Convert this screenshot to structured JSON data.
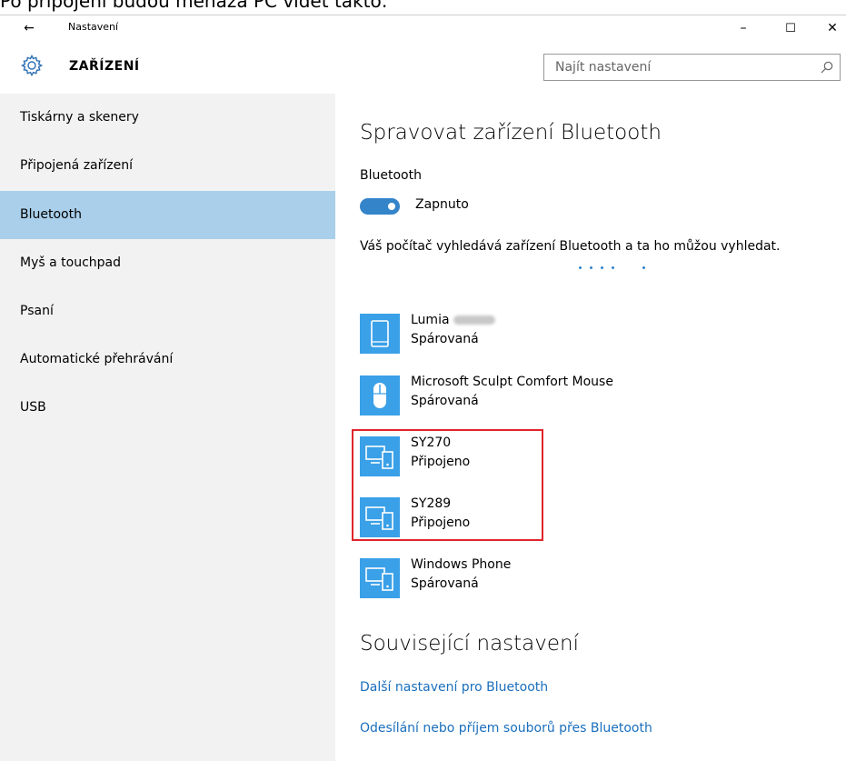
{
  "caption": "Po připojení budou menáža PČ vidět takto:",
  "window": {
    "app_title": "Nastavení",
    "controls": {
      "minimize": "–",
      "maximize": "☐",
      "close": "✕"
    }
  },
  "header": {
    "section_title": "ZAŘÍZENÍ",
    "search_placeholder": "Najít nastavení"
  },
  "sidebar": {
    "items": [
      {
        "label": "Tiskárny a skenery"
      },
      {
        "label": "Připojená zařízení"
      },
      {
        "label": "Bluetooth"
      },
      {
        "label": "Myš a touchpad"
      },
      {
        "label": "Psaní"
      },
      {
        "label": "Automatické přehrávání"
      },
      {
        "label": "USB"
      }
    ],
    "active": "Bluetooth"
  },
  "main": {
    "title": "Spravovat zařízení Bluetooth",
    "bluetooth_label": "Bluetooth",
    "toggle_state": "Zapnuto",
    "discover_text": "Váš počítač vyhledává zařízení Bluetooth a ta ho můžou vyhledat.",
    "devices": [
      {
        "name": "Lumia",
        "status": "Spárovaná",
        "icon": "phone-icon"
      },
      {
        "name": "Microsoft Sculpt Comfort Mouse",
        "status": "Spárovaná",
        "icon": "mouse-icon"
      },
      {
        "name": "SY270",
        "status": "Připojeno",
        "icon": "devices-icon"
      },
      {
        "name": "SY289",
        "status": "Připojeno",
        "icon": "devices-icon"
      },
      {
        "name": "Windows Phone",
        "status": "Spárovaná",
        "icon": "devices-icon"
      }
    ],
    "related_title": "Související nastavení",
    "links": [
      {
        "label": "Další nastavení pro Bluetooth"
      },
      {
        "label": "Odesílání nebo příjem souborů přes Bluetooth"
      }
    ]
  },
  "colors": {
    "accent": "#3484c9",
    "device_tile": "#3aa0e8",
    "sidebar_bg": "#f2f2f2",
    "sidebar_active": "#a9cfea",
    "highlight": "#e0252b",
    "link": "#1a6fbd"
  }
}
